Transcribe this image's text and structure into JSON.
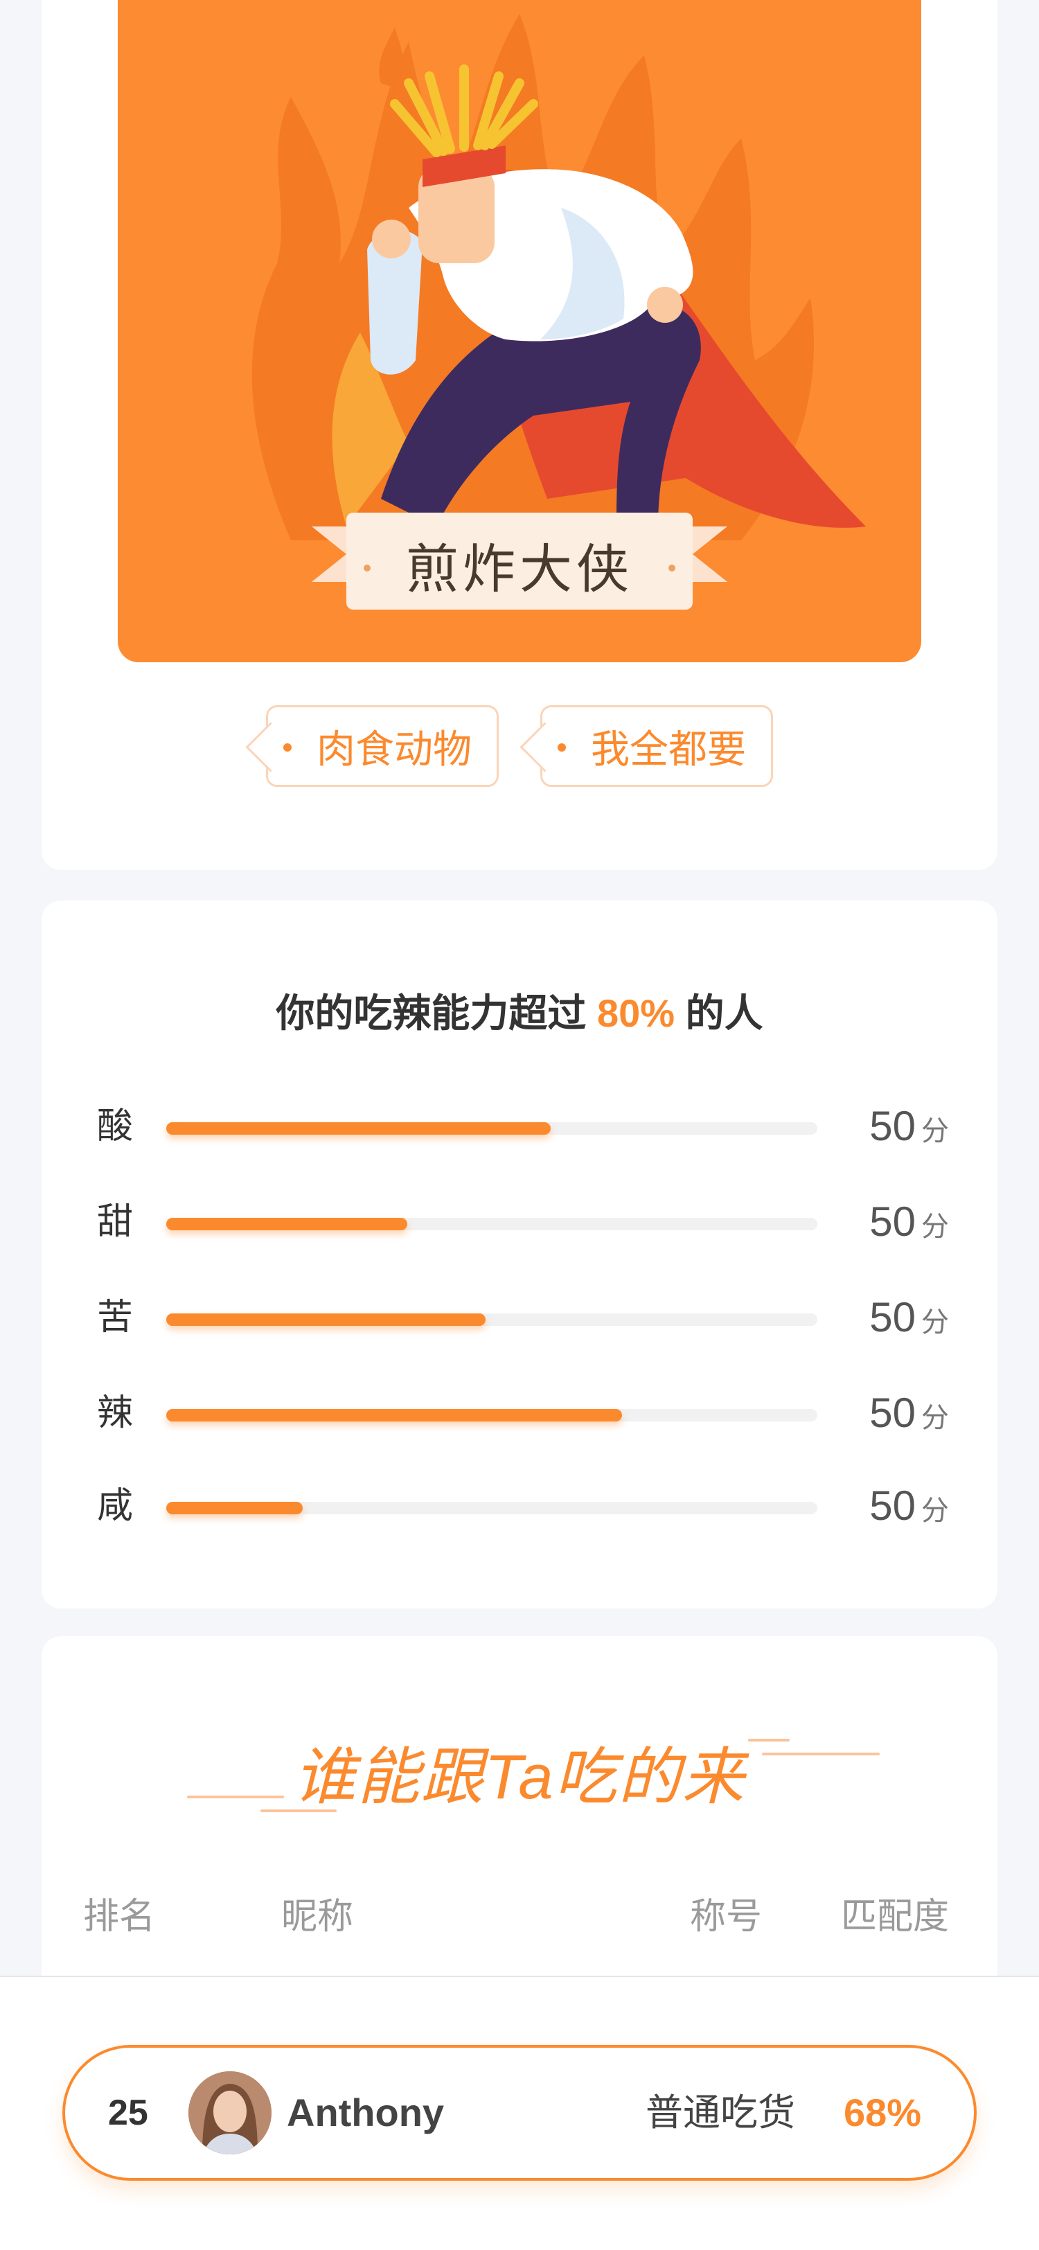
{
  "hero": {
    "ribbon_text": "煎炸大侠",
    "tags": [
      "肉食动物",
      "我全都要"
    ]
  },
  "taste": {
    "title_prefix": "你的吃辣能力超过",
    "title_percent": "80%",
    "title_suffix": "的人",
    "unit": "分",
    "items": [
      {
        "label": "酸",
        "score": "50",
        "fill": 0.59
      },
      {
        "label": "甜",
        "score": "50",
        "fill": 0.37
      },
      {
        "label": "苦",
        "score": "50",
        "fill": 0.49
      },
      {
        "label": "辣",
        "score": "50",
        "fill": 0.7
      },
      {
        "label": "咸",
        "score": "50",
        "fill": 0.21
      }
    ]
  },
  "ranking": {
    "title": "谁能跟Ta吃的来",
    "headers": {
      "rank": "排名",
      "nickname": "昵称",
      "title": "称号",
      "match": "匹配度"
    }
  },
  "my_rank": {
    "rank": "25",
    "name": "Anthony",
    "title": "普通吃货",
    "match": "68%"
  },
  "colors": {
    "accent": "#fb8a2e",
    "hero_bg": "#fd8b32",
    "cape": "#e64a2e",
    "pants": "#3e2b5e"
  }
}
